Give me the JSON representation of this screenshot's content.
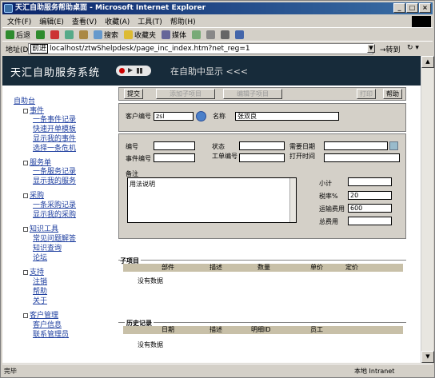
{
  "window": {
    "title": "天汇自助服务帮助桌面 - Microsoft Internet Explorer"
  },
  "menu": [
    "文件(F)",
    "编辑(E)",
    "查看(V)",
    "收藏(A)",
    "工具(T)",
    "帮助(H)"
  ],
  "toolbar": {
    "back": "后退",
    "search": "搜索",
    "favorites": "收藏夹",
    "media": "媒体"
  },
  "address": {
    "label": "地址(D)",
    "tag": "前进",
    "url": "localhost/ztwShelpdesk/page_inc_index.htm?net_reg=1",
    "go": "转到"
  },
  "banner": {
    "title": "天汇自助服务系统",
    "subtitle": "在自助中显示 <<<"
  },
  "nav": {
    "home": "自助台",
    "groups": [
      {
        "label": "事件",
        "items": [
          "一条事件记录",
          "快速开单模板",
          "显示我的事件",
          "选择一条危机"
        ]
      },
      {
        "label": "服务单",
        "items": [
          "一条服务记录",
          "显示我的服务"
        ]
      },
      {
        "label": "采购",
        "items": [
          "一条采购记录",
          "显示我的采购"
        ]
      },
      {
        "label": "知识工具",
        "items": [
          "常见问题解答",
          "知识查询",
          "论坛"
        ]
      },
      {
        "label": "支持",
        "items": [
          "注销",
          "帮助",
          "关于"
        ]
      },
      {
        "label": "客户管理",
        "items": [
          "客户信息",
          "联系管理员"
        ]
      }
    ]
  },
  "actions": {
    "submit": "提交",
    "add_child": "添加子项目",
    "edit_child": "编辑子项目",
    "print": "打印",
    "help": "帮助"
  },
  "customer": {
    "label": "客户编号",
    "value": "zsl",
    "name_label": "名称",
    "name_value": "张双良"
  },
  "fields": {
    "number": "编号",
    "status": "状态",
    "need_date": "需要日期",
    "event_no": "事件编号",
    "work_no": "工单编号",
    "open_time": "打开时间",
    "remark": "备注",
    "remark_value": "用法说明"
  },
  "totals": {
    "subtotal": "小计",
    "tax": "税率%",
    "tax_value": "20",
    "shipping": "运输费用",
    "shipping_value": "600",
    "total": "总费用"
  },
  "subitems": {
    "title": "子项目",
    "columns": [
      "部件",
      "描述",
      "数量",
      "单价",
      "定价"
    ],
    "empty": "没有数据"
  },
  "history": {
    "title": "历史记录",
    "columns": [
      "日期",
      "描述",
      "明细ID",
      "员工"
    ],
    "empty": "没有数据"
  },
  "status": {
    "left": "完毕",
    "right": "本地 Intranet"
  }
}
